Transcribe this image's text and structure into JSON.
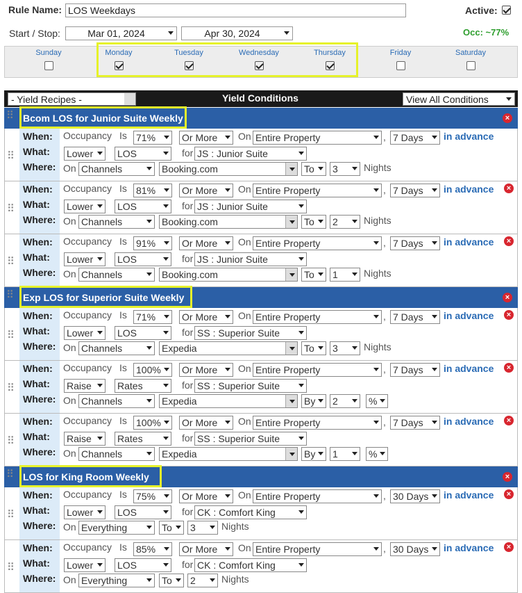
{
  "header": {
    "rule_name_label": "Rule Name:",
    "rule_name_value": "LOS Weekdays",
    "active_label": "Active:",
    "active_checked": true,
    "start_stop_label": "Start / Stop:",
    "start_date": "Mar 01, 2024",
    "stop_date": "Apr 30, 2024",
    "occ_text": "Occ: ~77%"
  },
  "days": [
    {
      "label": "Sunday",
      "checked": false
    },
    {
      "label": "Monday",
      "checked": true
    },
    {
      "label": "Tuesday",
      "checked": true
    },
    {
      "label": "Wednesday",
      "checked": true
    },
    {
      "label": "Thursday",
      "checked": true
    },
    {
      "label": "Friday",
      "checked": false
    },
    {
      "label": "Saturday",
      "checked": false
    }
  ],
  "yield_bar": {
    "recipes_select": "- Yield Recipes -",
    "title": "Yield Conditions",
    "view_select": "View All Conditions"
  },
  "row_labels": {
    "when": "When:",
    "what": "What:",
    "where": "Where:"
  },
  "static_text": {
    "occupancy": "Occupancy",
    "is": "Is",
    "on": "On",
    "comma": ",",
    "in_advance": "in advance",
    "for": "for",
    "nights": "Nights"
  },
  "sections": [
    {
      "name": "Bcom LOS for Junior Suite Weekly",
      "rules": [
        {
          "occ": "71%",
          "cmp": "Or More",
          "scope": "Entire Property",
          "days": "7 Days",
          "action": "Lower",
          "target": "LOS",
          "room": "JS : Junior Suite",
          "where_type": "Channels",
          "channel": "Booking.com",
          "mode": "To",
          "amount": "3",
          "unit": "",
          "has_delete": false
        },
        {
          "occ": "81%",
          "cmp": "Or More",
          "scope": "Entire Property",
          "days": "7 Days",
          "action": "Lower",
          "target": "LOS",
          "room": "JS : Junior Suite",
          "where_type": "Channels",
          "channel": "Booking.com",
          "mode": "To",
          "amount": "2",
          "unit": "",
          "has_delete": true
        },
        {
          "occ": "91%",
          "cmp": "Or More",
          "scope": "Entire Property",
          "days": "7 Days",
          "action": "Lower",
          "target": "LOS",
          "room": "JS : Junior Suite",
          "where_type": "Channels",
          "channel": "Booking.com",
          "mode": "To",
          "amount": "1",
          "unit": "",
          "has_delete": true
        }
      ]
    },
    {
      "name": "Exp LOS for Superior Suite Weekly",
      "rules": [
        {
          "occ": "71%",
          "cmp": "Or More",
          "scope": "Entire Property",
          "days": "7 Days",
          "action": "Lower",
          "target": "LOS",
          "room": "SS : Superior Suite",
          "where_type": "Channels",
          "channel": "Expedia",
          "mode": "To",
          "amount": "3",
          "unit": "",
          "has_delete": true
        },
        {
          "occ": "100%",
          "cmp": "Or More",
          "scope": "Entire Property",
          "days": "7 Days",
          "action": "Raise",
          "target": "Rates",
          "room": "SS : Superior Suite",
          "where_type": "Channels",
          "channel": "Expedia",
          "mode": "By",
          "amount": "2",
          "unit": "%",
          "has_delete": true
        },
        {
          "occ": "100%",
          "cmp": "Or More",
          "scope": "Entire Property",
          "days": "7 Days",
          "action": "Raise",
          "target": "Rates",
          "room": "SS : Superior Suite",
          "where_type": "Channels",
          "channel": "Expedia",
          "mode": "By",
          "amount": "1",
          "unit": "%",
          "has_delete": true
        }
      ]
    },
    {
      "name": "LOS for King Room Weekly",
      "rules": [
        {
          "occ": "75%",
          "cmp": "Or More",
          "scope": "Entire Property",
          "days": "30 Days",
          "action": "Lower",
          "target": "LOS",
          "room": "CK : Comfort King",
          "where_type": "Everything",
          "channel": "",
          "mode": "To",
          "amount": "3",
          "unit": "",
          "has_delete": true
        },
        {
          "occ": "85%",
          "cmp": "Or More",
          "scope": "Entire Property",
          "days": "30 Days",
          "action": "Lower",
          "target": "LOS",
          "room": "CK : Comfort King",
          "where_type": "Everything",
          "channel": "",
          "mode": "To",
          "amount": "2",
          "unit": "",
          "has_delete": true
        }
      ]
    }
  ],
  "colors": {
    "accent": "#2b5fa6",
    "highlight": "#e6f22a",
    "delete": "#d8262f",
    "occ_green": "#2e9e2e"
  }
}
